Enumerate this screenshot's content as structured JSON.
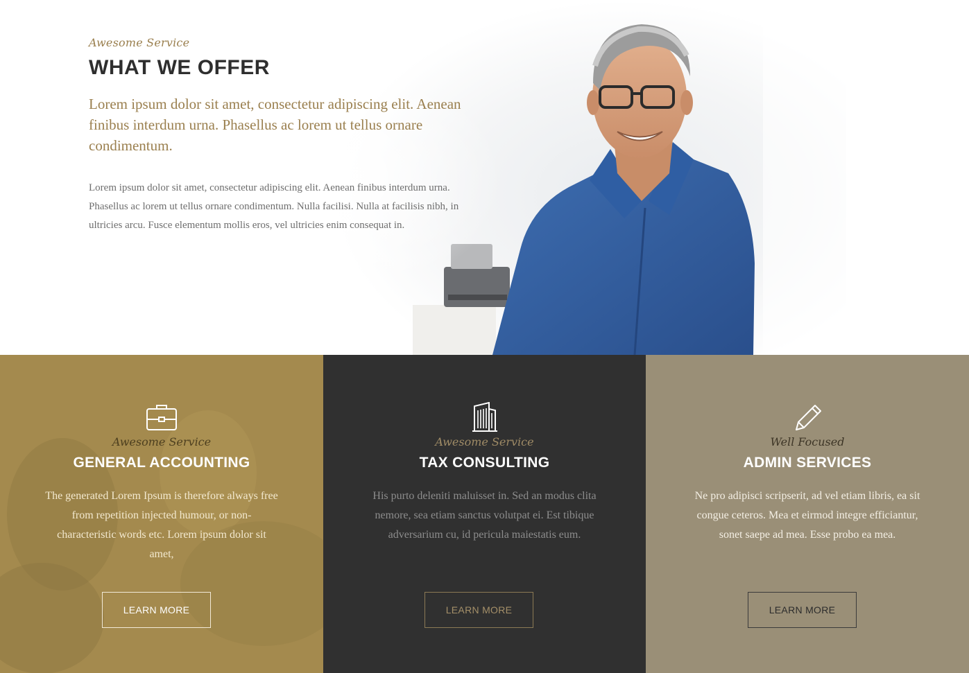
{
  "hero": {
    "kicker": "Awesome Service",
    "title": "WHAT WE OFFER",
    "lead": "Lorem ipsum dolor sit amet, consectetur adipiscing elit. Aenean finibus interdum urna. Phasellus ac lorem ut tellus ornare condimentum.",
    "body": "Lorem ipsum dolor sit amet, consectetur adipiscing elit. Aenean finibus interdum urna. Phasellus ac lorem ut tellus ornare condimentum. Nulla facilisi. Nulla at facilisis nibh, in ultricies arcu. Fusce elementum mollis eros, vel ultricies enim consequat in."
  },
  "services": [
    {
      "icon": "briefcase-icon",
      "kicker": "Awesome Service",
      "title": "GENERAL ACCOUNTING",
      "description": "The generated Lorem Ipsum is therefore always free from repetition injected humour, or non-characteristic words etc. Lorem ipsum dolor sit amet,",
      "button": "LEARN MORE",
      "background": "#a48a4e"
    },
    {
      "icon": "building-icon",
      "kicker": "Awesome Service",
      "title": "TAX CONSULTING",
      "description": "His purto deleniti maluisset in. Sed an modus clita nemore, sea etiam sanctus volutpat ei. Est tibique adversarium cu, id pericula maiestatis eum.",
      "button": "LEARN MORE",
      "background": "#303030"
    },
    {
      "icon": "pencil-icon",
      "kicker": "Well Focused",
      "title": "ADMIN SERVICES",
      "description": "Ne pro adipisci scripserit, ad vel etiam libris, ea sit congue ceteros. Mea et eirmod integre efficiantur, sonet saepe ad mea. Esse probo ea mea.",
      "button": "LEARN MORE",
      "background": "#9a8f77"
    }
  ],
  "colors": {
    "accent_gold": "#9a7f4e",
    "heading_dark": "#2e2e2e"
  }
}
